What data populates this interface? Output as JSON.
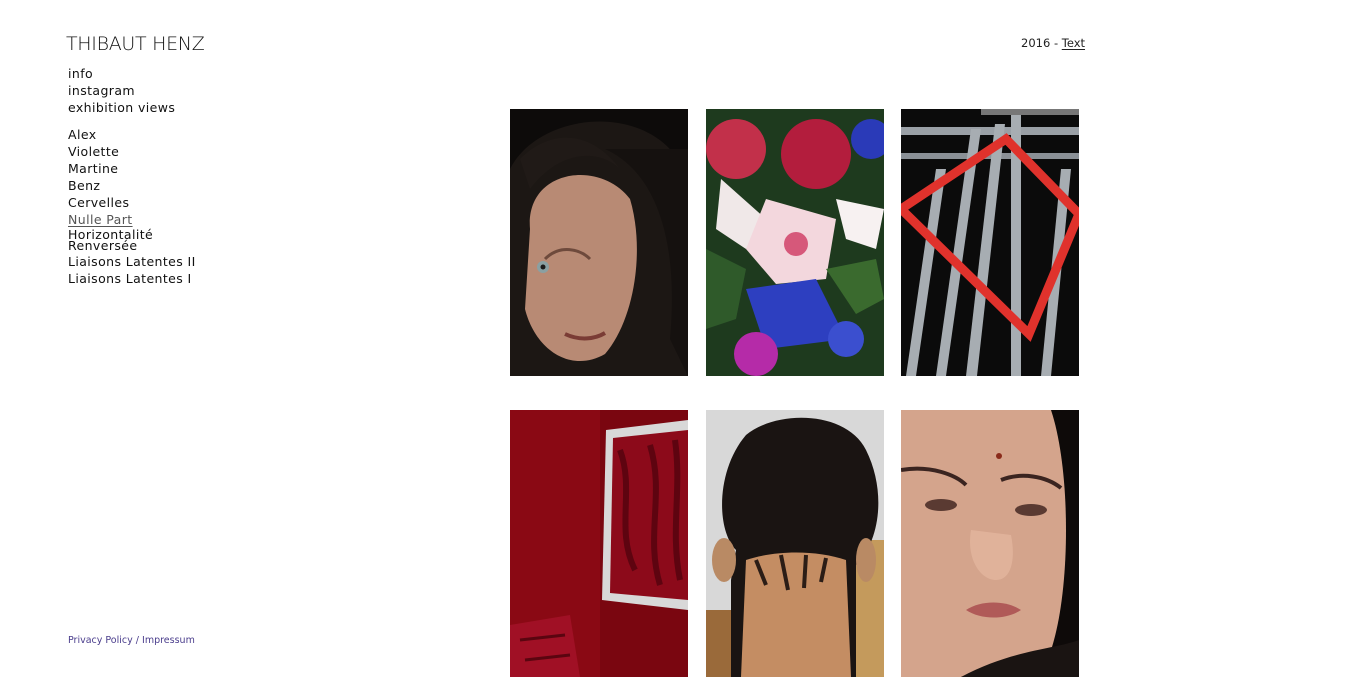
{
  "header": {
    "site_title": "THIBAUT HENZ"
  },
  "nav": {
    "primary": [
      "info",
      "instagram",
      "exhibition views"
    ],
    "projects": [
      {
        "label": "Alex"
      },
      {
        "label": "Violette"
      },
      {
        "label": "Martine"
      },
      {
        "label": "Benz"
      },
      {
        "label": "Cervelles"
      },
      {
        "label": "Nulle Part",
        "active": true
      },
      {
        "label_line1": "Horizontalité",
        "label_line2": "Renversée"
      },
      {
        "label": "Liaisons Latentes II"
      },
      {
        "label": "Liaisons Latentes I"
      }
    ]
  },
  "project_meta": {
    "year": "2016",
    "separator": "-",
    "text_link": "Text"
  },
  "footer": {
    "privacy": "Privacy Policy",
    "separator": "/",
    "impressum": "Impressum"
  },
  "colors": {
    "footer_link": "#4a3d8c",
    "background": "#ffffff"
  },
  "gallery": [
    {
      "subject": "portrait of a man with long dark curly hair"
    },
    {
      "subject": "bouquet of artificial flowers"
    },
    {
      "subject": "red frame on metal barrier"
    },
    {
      "subject": "red wall with framed red curtain"
    },
    {
      "subject": "back of a head with short hair"
    },
    {
      "subject": "close-up face of a woman"
    }
  ]
}
